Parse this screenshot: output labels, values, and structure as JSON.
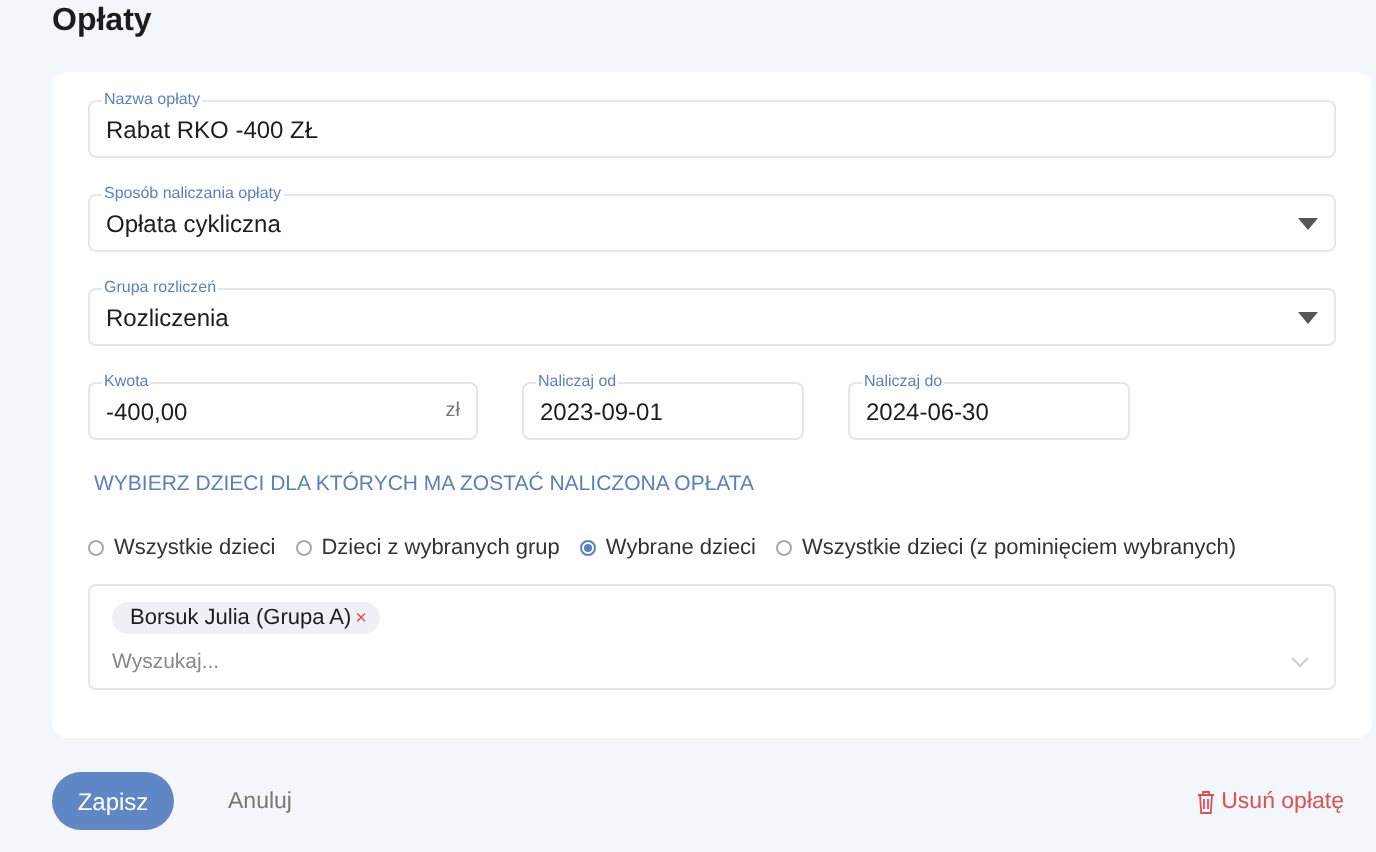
{
  "page_title": "Opłaty",
  "fields": [
    {
      "kind": "text",
      "label": "Nazwa opłaty",
      "value": "Rabat RKO -400 ZŁ"
    },
    {
      "kind": "select",
      "label": "Sposób naliczania opłaty",
      "value": "Opłata cykliczna"
    },
    {
      "kind": "select",
      "label": "Grupa rozliczeń",
      "value": "Rozliczenia"
    }
  ],
  "small_fields": [
    {
      "label": "Kwota",
      "value": "-400,00",
      "suffix": "zł"
    },
    {
      "label": "Naliczaj od",
      "value": "2023-09-01"
    },
    {
      "label": "Naliczaj do",
      "value": "2024-06-30"
    }
  ],
  "section_heading": "WYBIERZ DZIECI DLA KTÓRYCH MA ZOSTAĆ NALICZONA OPŁATA",
  "radios": [
    {
      "label": "Wszystkie dzieci",
      "selected": false
    },
    {
      "label": "Dzieci z wybranych grup",
      "selected": false
    },
    {
      "label": "Wybrane dzieci",
      "selected": true
    },
    {
      "label": "Wszystkie dzieci (z pominięciem wybranych)",
      "selected": false
    }
  ],
  "multiselect": {
    "tags": [
      {
        "label": "Borsuk Julia (Grupa A)",
        "remove": "×"
      }
    ],
    "placeholder": "Wyszukaj..."
  },
  "buttons": {
    "save": "Zapisz",
    "cancel": "Anuluj",
    "delete": "Usuń opłatę"
  }
}
